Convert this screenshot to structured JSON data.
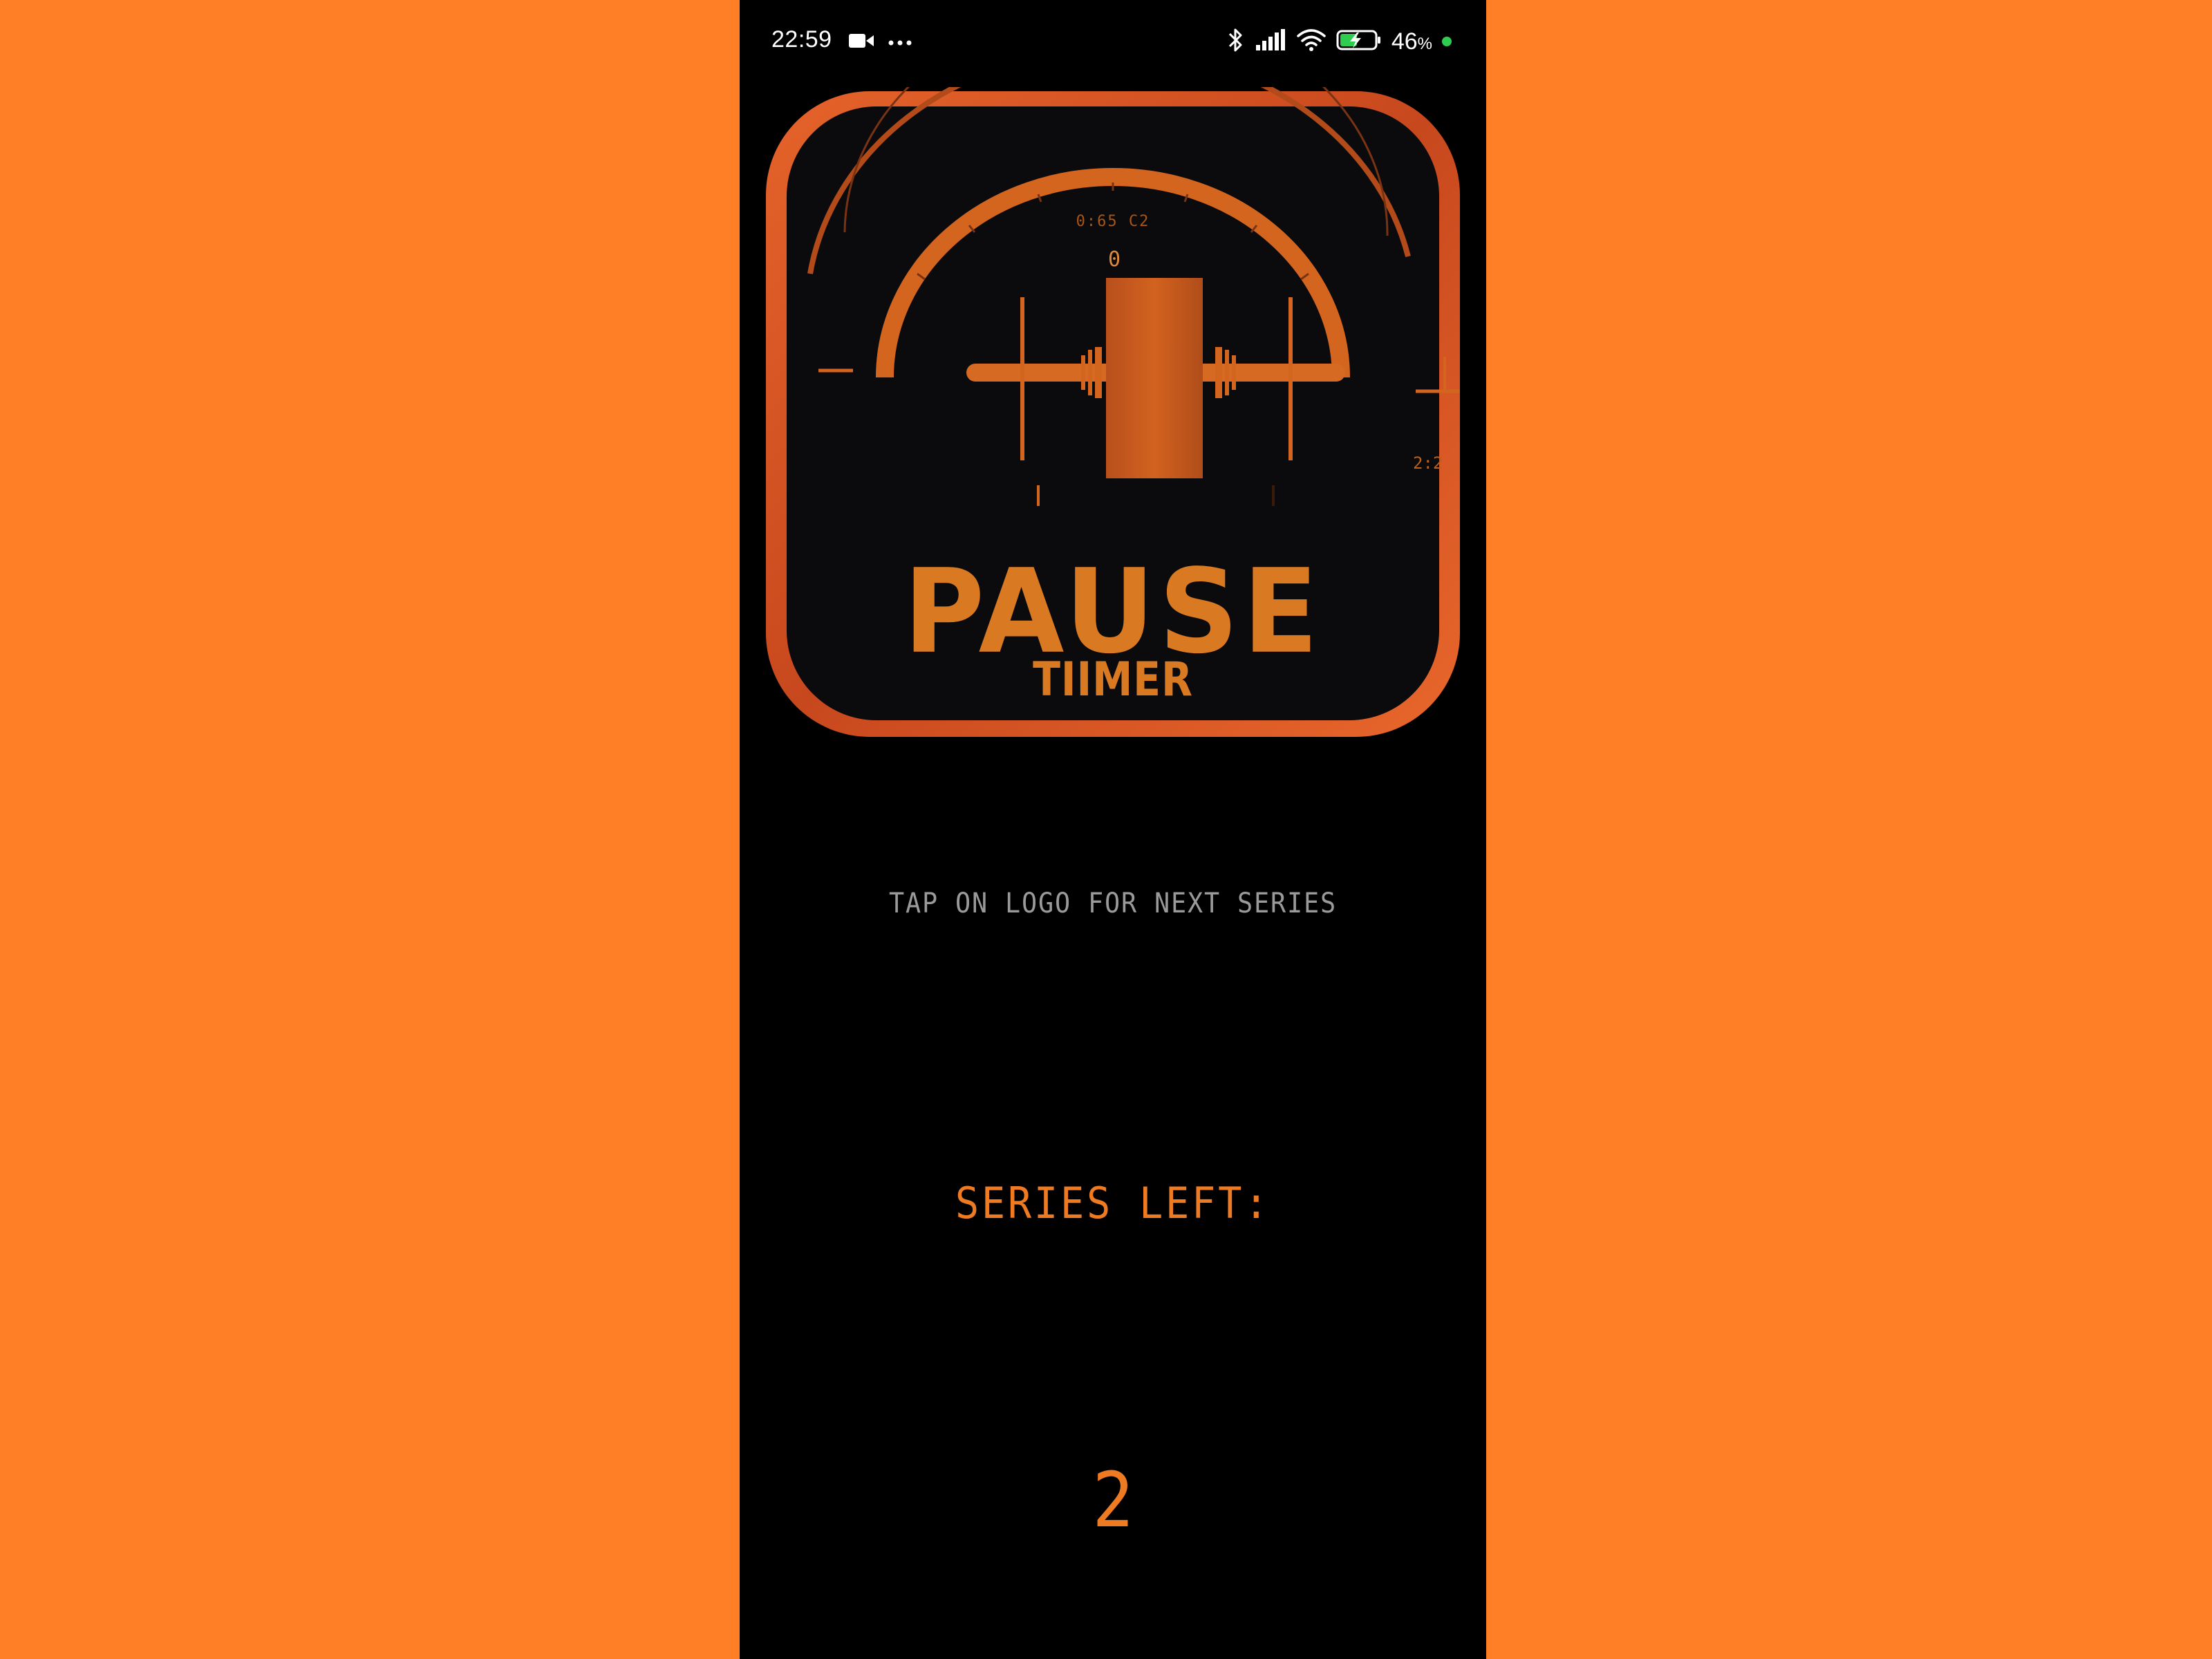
{
  "status_bar": {
    "time": "22:59",
    "battery_percent": "46",
    "battery_percent_sign": "%",
    "icons_left": [
      "video-camera-icon",
      "more-dots-icon"
    ],
    "icons_right": [
      "bluetooth-icon",
      "signal-icon",
      "wifi-icon",
      "battery-charging-icon",
      "active-dot-icon"
    ]
  },
  "logo": {
    "title": "PAUSE",
    "subtitle": "TIIMER",
    "dial_top_readout": "0:65 C2",
    "dial_value": "0",
    "side_readout": "2:2"
  },
  "main": {
    "hint": "TAP ON LOGO FOR NEXT SERIES",
    "series_label": "SERIES LEFT:",
    "series_count": "2"
  },
  "colors": {
    "background": "#ff7f26",
    "screen": "#000000",
    "accent": "#ee7a22",
    "hint_text": "#9a9a9a"
  }
}
